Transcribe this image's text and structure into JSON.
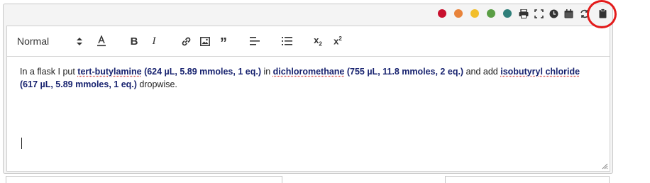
{
  "editor": {
    "format_select": "Normal",
    "colors": [
      "#c8102e",
      "#e8833a",
      "#f2be2a",
      "#5a9e45",
      "#2f7f7a"
    ],
    "top_icons": [
      "print-icon",
      "fullscreen-icon",
      "clock-icon",
      "calendar-icon",
      "sync-icon",
      "clipboard-icon"
    ],
    "toolbar_icons": [
      "bold-icon",
      "italic-icon",
      "link-icon",
      "image-icon",
      "quote-icon",
      "align-left-icon",
      "list-icon",
      "subscript-icon",
      "superscript-icon"
    ]
  },
  "content": {
    "t1": "In a flask I put ",
    "r1_name": "tert-butylamine",
    "r1_detail": " (624 µL, 5.89 mmoles, 1 eq.)",
    "t2": " in ",
    "r2_name": "dichloromethane",
    "r2_detail": " (755 µL, 11.8 mmoles, 2 eq.)",
    "t3": " and add ",
    "r3_name": "isobutyryl chloride",
    "r3_detail": " (617 µL, 5.89 mmoles, 1 eq.)",
    "t4": " dropwise."
  }
}
